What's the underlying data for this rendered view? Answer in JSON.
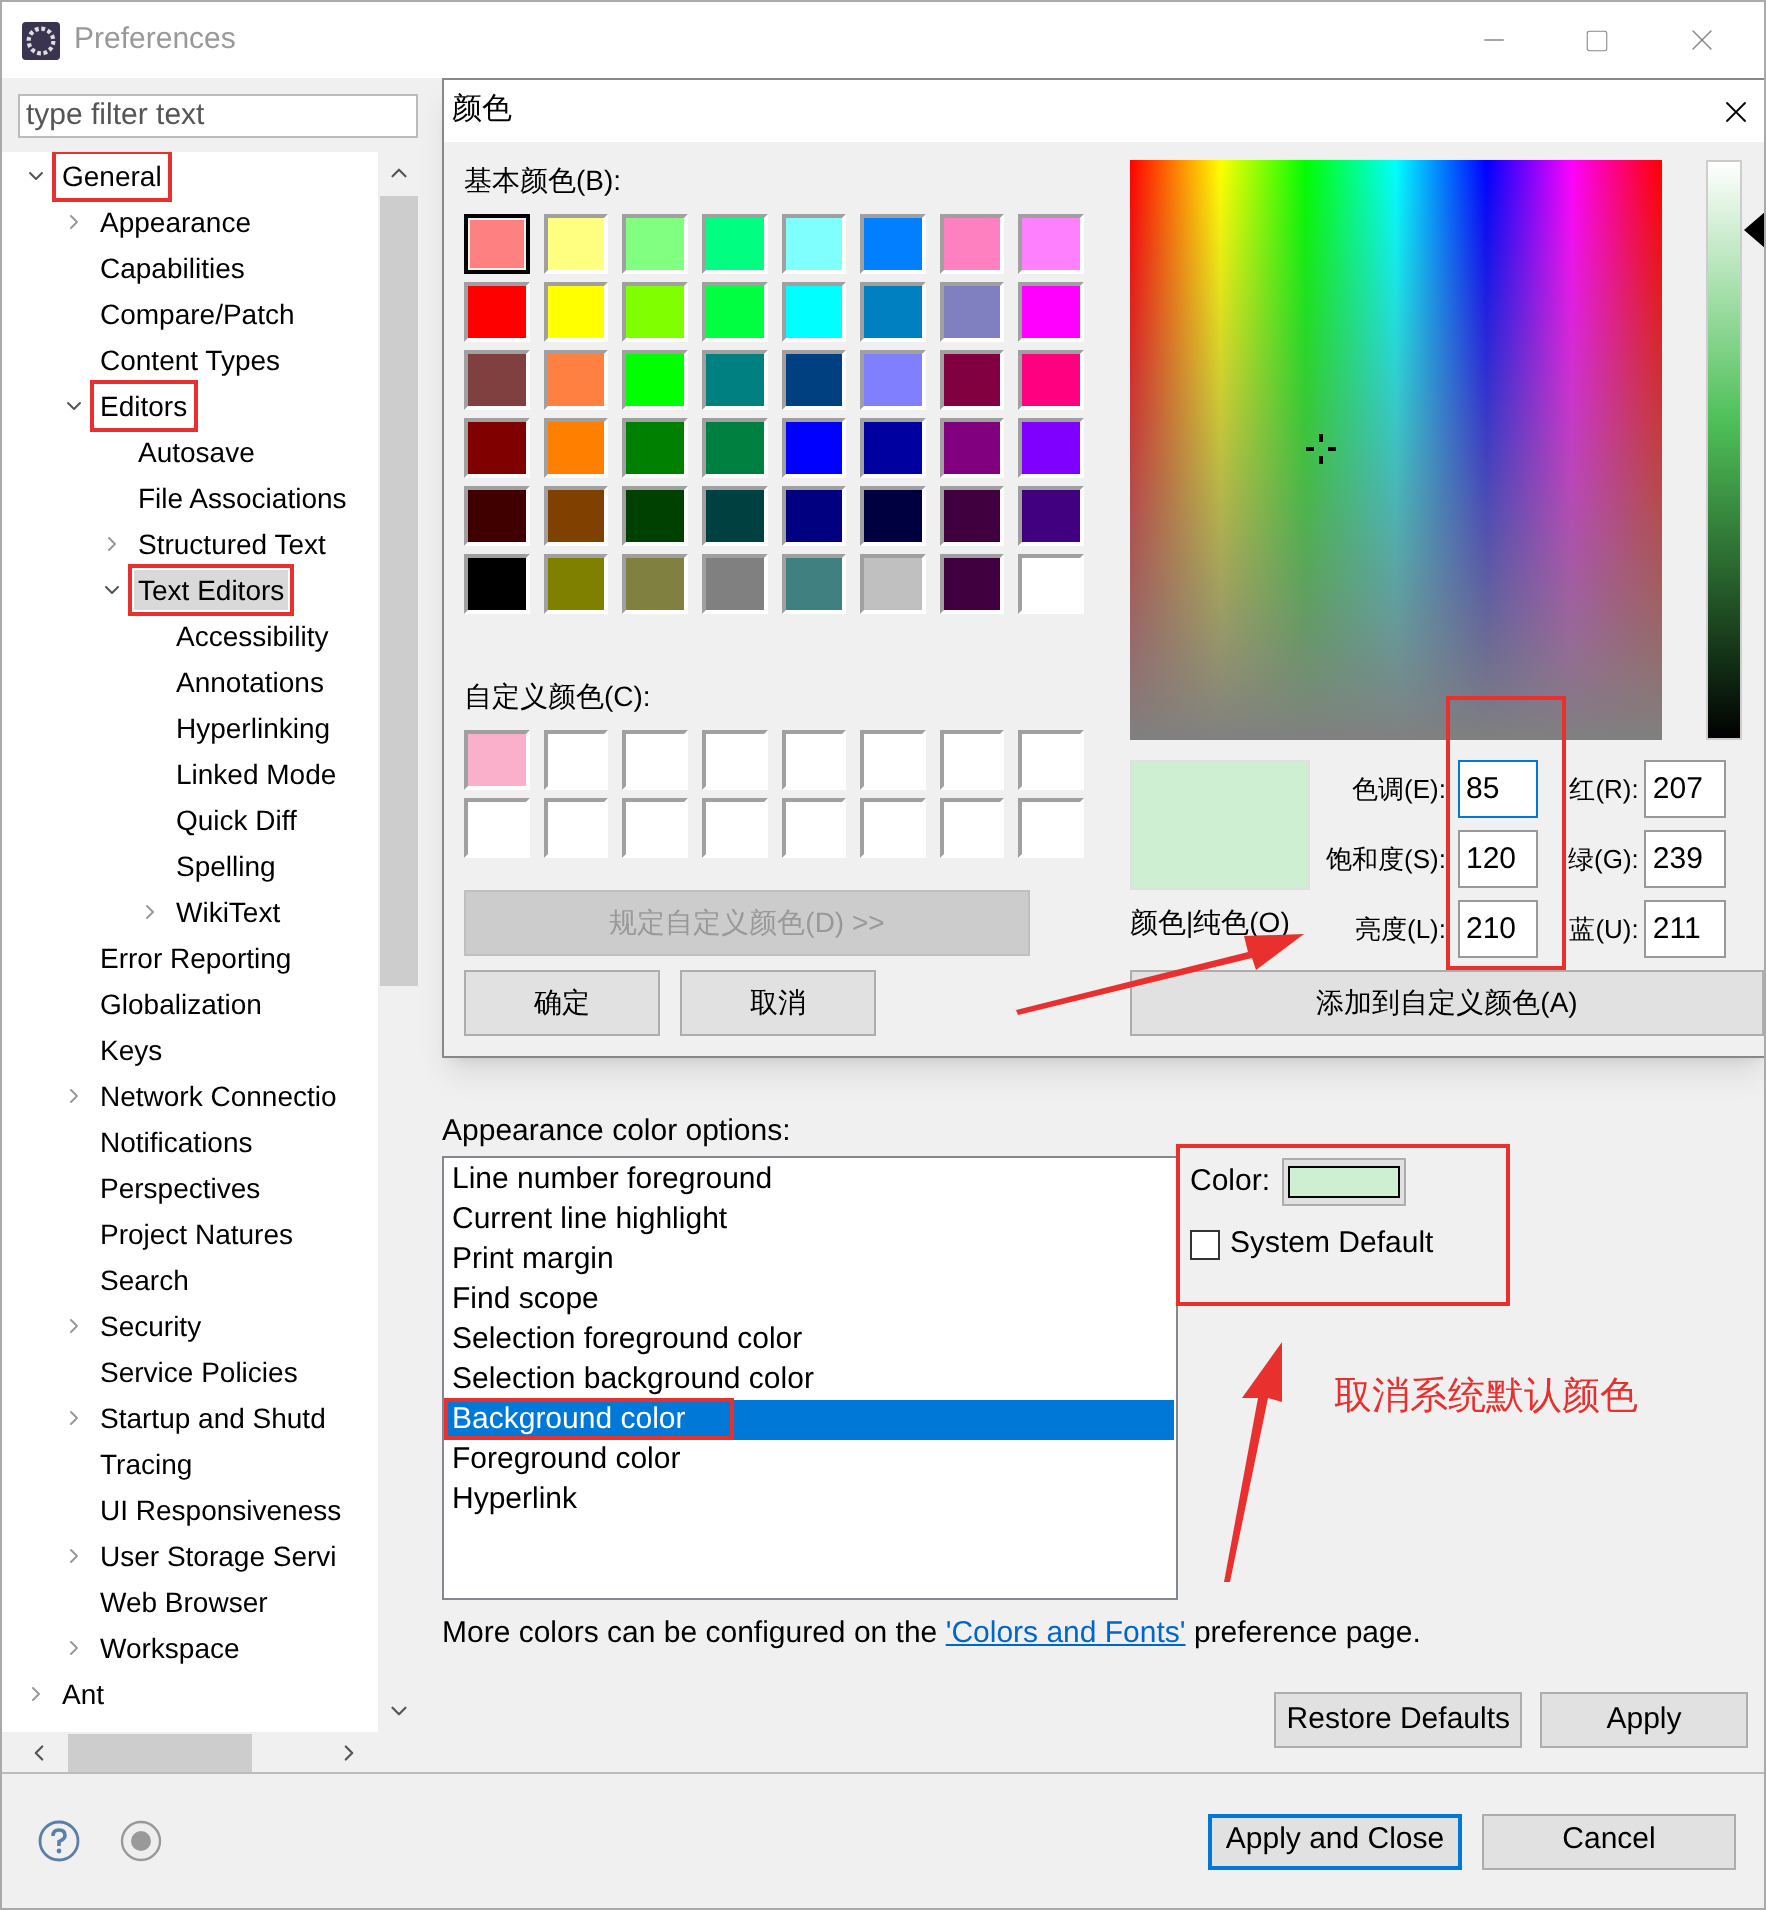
{
  "window": {
    "title": "Preferences"
  },
  "filter": {
    "placeholder": "type filter text"
  },
  "tree": [
    {
      "label": "General",
      "expanded": true,
      "selected": false,
      "marked": true,
      "children": [
        {
          "label": "Appearance",
          "expanded": false,
          "selected": false,
          "marked": false
        },
        {
          "label": "Capabilities",
          "selected": false,
          "marked": false
        },
        {
          "label": "Compare/Patch",
          "selected": false,
          "marked": false
        },
        {
          "label": "Content Types",
          "selected": false,
          "marked": false
        },
        {
          "label": "Editors",
          "expanded": true,
          "selected": false,
          "marked": true,
          "children": [
            {
              "label": "Autosave",
              "selected": false,
              "marked": false
            },
            {
              "label": "File Associations",
              "selected": false,
              "marked": false
            },
            {
              "label": "Structured Text",
              "expanded": false,
              "selected": false,
              "marked": false
            },
            {
              "label": "Text Editors",
              "expanded": true,
              "selected": true,
              "marked": true,
              "children": [
                {
                  "label": "Accessibility",
                  "selected": false,
                  "marked": false
                },
                {
                  "label": "Annotations",
                  "selected": false,
                  "marked": false
                },
                {
                  "label": "Hyperlinking",
                  "selected": false,
                  "marked": false
                },
                {
                  "label": "Linked Mode",
                  "selected": false,
                  "marked": false
                },
                {
                  "label": "Quick Diff",
                  "selected": false,
                  "marked": false
                },
                {
                  "label": "Spelling",
                  "selected": false,
                  "marked": false
                },
                {
                  "label": "WikiText",
                  "expanded": false,
                  "selected": false,
                  "marked": false
                }
              ]
            }
          ]
        },
        {
          "label": "Error Reporting",
          "selected": false,
          "marked": false
        },
        {
          "label": "Globalization",
          "selected": false,
          "marked": false
        },
        {
          "label": "Keys",
          "selected": false,
          "marked": false
        },
        {
          "label": "Network Connectio",
          "expanded": false,
          "selected": false,
          "marked": false
        },
        {
          "label": "Notifications",
          "selected": false,
          "marked": false
        },
        {
          "label": "Perspectives",
          "selected": false,
          "marked": false
        },
        {
          "label": "Project Natures",
          "selected": false,
          "marked": false
        },
        {
          "label": "Search",
          "selected": false,
          "marked": false
        },
        {
          "label": "Security",
          "expanded": false,
          "selected": false,
          "marked": false
        },
        {
          "label": "Service Policies",
          "selected": false,
          "marked": false
        },
        {
          "label": "Startup and Shutd",
          "expanded": false,
          "selected": false,
          "marked": false
        },
        {
          "label": "Tracing",
          "selected": false,
          "marked": false
        },
        {
          "label": "UI Responsiveness",
          "selected": false,
          "marked": false
        },
        {
          "label": "User Storage Servi",
          "expanded": false,
          "selected": false,
          "marked": false
        },
        {
          "label": "Web Browser",
          "selected": false,
          "marked": false
        },
        {
          "label": "Workspace",
          "expanded": false,
          "selected": false,
          "marked": false
        }
      ]
    },
    {
      "label": "Ant",
      "expanded": false,
      "selected": false,
      "marked": false
    }
  ],
  "page": {
    "options_label": "Appearance color options:",
    "options": [
      {
        "label": "Line number foreground",
        "selected": false,
        "marked": false
      },
      {
        "label": "Current line highlight",
        "selected": false,
        "marked": false
      },
      {
        "label": "Print margin",
        "selected": false,
        "marked": false
      },
      {
        "label": "Find scope",
        "selected": false,
        "marked": false
      },
      {
        "label": "Selection foreground color",
        "selected": false,
        "marked": false
      },
      {
        "label": "Selection background color",
        "selected": false,
        "marked": false
      },
      {
        "label": "Background color",
        "selected": true,
        "marked": true
      },
      {
        "label": "Foreground color",
        "selected": false,
        "marked": false
      },
      {
        "label": "Hyperlink",
        "selected": false,
        "marked": false
      }
    ],
    "color_label": "Color:",
    "color": "#cfefd3",
    "system_default": {
      "label": "System Default",
      "checked": false
    },
    "note": "More colors can be configured on the ",
    "note_link": "'Colors and Fonts'",
    "note_end": " preference page.",
    "buttons": [
      "Restore Defaults",
      "Apply"
    ]
  },
  "footer_buttons": [
    {
      "label": "Apply and Close",
      "default": true
    },
    {
      "label": "Cancel",
      "default": false
    }
  ],
  "color_dialog": {
    "title": "颜色",
    "basic_label": "基本颜色(B):",
    "basic_colors": [
      {
        "color": "#ff8080",
        "selected": true
      },
      {
        "color": "#ffff80",
        "selected": false
      },
      {
        "color": "#80ff80",
        "selected": false
      },
      {
        "color": "#00ff80",
        "selected": false
      },
      {
        "color": "#80ffff",
        "selected": false
      },
      {
        "color": "#0080ff",
        "selected": false
      },
      {
        "color": "#ff80c0",
        "selected": false
      },
      {
        "color": "#ff80ff",
        "selected": false
      },
      {
        "color": "#ff0000",
        "selected": false
      },
      {
        "color": "#ffff00",
        "selected": false
      },
      {
        "color": "#80ff00",
        "selected": false
      },
      {
        "color": "#00ff40",
        "selected": false
      },
      {
        "color": "#00ffff",
        "selected": false
      },
      {
        "color": "#0080c0",
        "selected": false
      },
      {
        "color": "#8080c0",
        "selected": false
      },
      {
        "color": "#ff00ff",
        "selected": false
      },
      {
        "color": "#804040",
        "selected": false
      },
      {
        "color": "#ff8040",
        "selected": false
      },
      {
        "color": "#00ff00",
        "selected": false
      },
      {
        "color": "#008080",
        "selected": false
      },
      {
        "color": "#004080",
        "selected": false
      },
      {
        "color": "#8080ff",
        "selected": false
      },
      {
        "color": "#800040",
        "selected": false
      },
      {
        "color": "#ff0080",
        "selected": false
      },
      {
        "color": "#800000",
        "selected": false
      },
      {
        "color": "#ff8000",
        "selected": false
      },
      {
        "color": "#008000",
        "selected": false
      },
      {
        "color": "#008040",
        "selected": false
      },
      {
        "color": "#0000ff",
        "selected": false
      },
      {
        "color": "#0000a0",
        "selected": false
      },
      {
        "color": "#800080",
        "selected": false
      },
      {
        "color": "#8000ff",
        "selected": false
      },
      {
        "color": "#400000",
        "selected": false
      },
      {
        "color": "#804000",
        "selected": false
      },
      {
        "color": "#004000",
        "selected": false
      },
      {
        "color": "#004040",
        "selected": false
      },
      {
        "color": "#000080",
        "selected": false
      },
      {
        "color": "#000040",
        "selected": false
      },
      {
        "color": "#400040",
        "selected": false
      },
      {
        "color": "#400080",
        "selected": false
      },
      {
        "color": "#000000",
        "selected": false
      },
      {
        "color": "#808000",
        "selected": false
      },
      {
        "color": "#808040",
        "selected": false
      },
      {
        "color": "#808080",
        "selected": false
      },
      {
        "color": "#408080",
        "selected": false
      },
      {
        "color": "#c0c0c0",
        "selected": false
      },
      {
        "color": "#400040",
        "selected": false
      },
      {
        "color": "#ffffff",
        "selected": false
      }
    ],
    "custom_label": "自定义颜色(C):",
    "custom_colors": [
      {
        "color": "#fab0cb"
      },
      {
        "color": "#ffffff"
      },
      {
        "color": "#ffffff"
      },
      {
        "color": "#ffffff"
      },
      {
        "color": "#ffffff"
      },
      {
        "color": "#ffffff"
      },
      {
        "color": "#ffffff"
      },
      {
        "color": "#ffffff"
      },
      {
        "color": "#ffffff"
      },
      {
        "color": "#ffffff"
      },
      {
        "color": "#ffffff"
      },
      {
        "color": "#ffffff"
      },
      {
        "color": "#ffffff"
      },
      {
        "color": "#ffffff"
      },
      {
        "color": "#ffffff"
      },
      {
        "color": "#ffffff"
      }
    ],
    "define_button": "规定自定义颜色(D) >>",
    "ok_button": "确定",
    "cancel_button": "取消",
    "luminance": {
      "level": 0.88
    },
    "preview": {
      "color": "#cfefd3",
      "label": "颜色|纯色(O)"
    },
    "hsl_fields": [
      {
        "label": "色调(E):",
        "value": "85",
        "focused": true
      },
      {
        "label": "饱和度(S):",
        "value": "120",
        "focused": false
      },
      {
        "label": "亮度(L):",
        "value": "210",
        "focused": false
      }
    ],
    "rgb_fields": [
      {
        "label": "红(R):",
        "value": "207",
        "focused": false
      },
      {
        "label": "绿(G):",
        "value": "239",
        "focused": false
      },
      {
        "label": "蓝(U):",
        "value": "211",
        "focused": false
      }
    ],
    "add_button": "添加到自定义颜色(A)"
  },
  "annotation": {
    "note": "取消系统默认颜色"
  }
}
